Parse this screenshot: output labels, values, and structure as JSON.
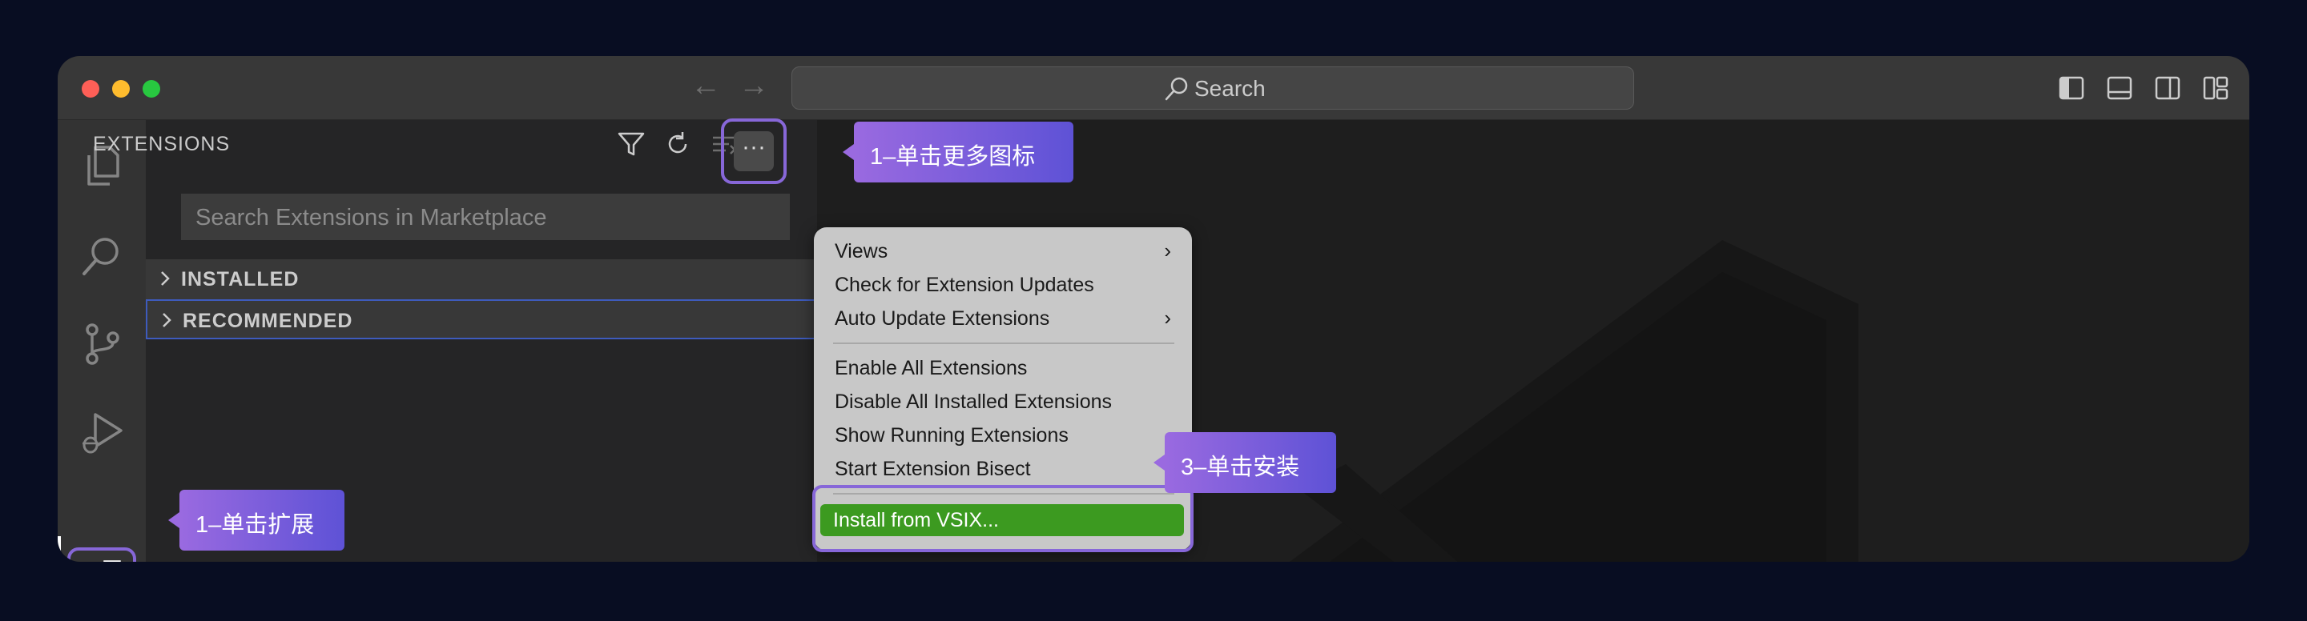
{
  "titlebar": {
    "search_label": "Search"
  },
  "sidebar": {
    "title": "EXTENSIONS",
    "search_placeholder": "Search Extensions in Marketplace",
    "sections": [
      {
        "label": "INSTALLED"
      },
      {
        "label": "RECOMMENDED"
      }
    ],
    "more_label": "···"
  },
  "menu": {
    "items": [
      {
        "label": "Views",
        "submenu": "›"
      },
      {
        "label": "Check for Extension Updates"
      },
      {
        "label": "Auto Update Extensions",
        "submenu": "›"
      },
      {
        "label": "Enable All Extensions"
      },
      {
        "label": "Disable All Installed Extensions"
      },
      {
        "label": "Show Running Extensions"
      },
      {
        "label": "Start Extension Bisect"
      },
      {
        "label": "Install from VSIX..."
      }
    ]
  },
  "callouts": {
    "more": "1–单击更多图标",
    "extensions": "1–单击扩展",
    "install": "3–单击安装"
  },
  "colors": {
    "accent_purple": "#8767d8",
    "install_green": "#3c9a20",
    "background": "#080d22"
  }
}
